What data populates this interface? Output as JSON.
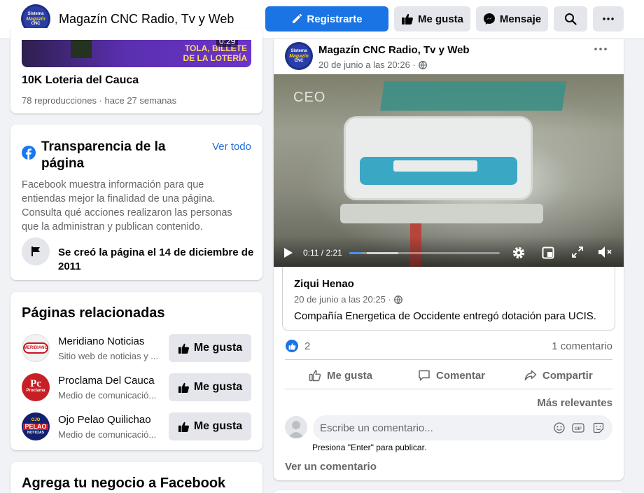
{
  "topbar": {
    "page_name": "Magazín CNC Radio, Tv y Web",
    "register_label": "Registrarte",
    "like_label": "Me gusta",
    "message_label": "Mensaje"
  },
  "video_card": {
    "duration_badge": "0:29",
    "banner_text": "TOLA, BILLETE DE LA LOTERÍA",
    "title": "10K Loteria del Cauca",
    "meta": "78 reproducciones · hace 27 semanas"
  },
  "transparency": {
    "title": "Transparencia de la página",
    "see_all": "Ver todo",
    "description": "Facebook muestra información para que entiendas mejor la finalidad de una página. Consulta qué acciones realizaron las personas que la administran y publican contenido.",
    "created": "Se creó la página el 14 de diciembre de 2011"
  },
  "related": {
    "title": "Páginas relacionadas",
    "like_label": "Me gusta",
    "items": [
      {
        "name": "Meridiano Noticias",
        "desc": "Sitio web de noticias y ..."
      },
      {
        "name": "Proclama Del Cauca",
        "desc": "Medio de comunicació..."
      },
      {
        "name": "Ojo Pelao Quilichao",
        "desc": "Medio de comunicació..."
      }
    ]
  },
  "business": {
    "title": "Agrega tu negocio a Facebook"
  },
  "post": {
    "author": "Magazín CNC Radio, Tv y Web",
    "date": "20 de junio a las 20:26 ·",
    "video": {
      "watermark": "CEO",
      "time": "0:11 / 2:21",
      "progress": 0.08
    },
    "shared": {
      "author": "Ziqui Henao",
      "date": "20 de junio a las 20:25 ·",
      "text": "Compañía Energetica de Occidente entregó dotación para UCIS."
    },
    "reactions_count": "2",
    "comments_count": "1 comentario",
    "actions": {
      "like": "Me gusta",
      "comment": "Comentar",
      "share": "Compartir"
    },
    "sort_label": "Más relevantes",
    "comment_placeholder": "Escribe un comentario...",
    "enter_hint": "Presiona \"Enter\" para publicar.",
    "view_comment": "Ver un comentario"
  },
  "colors": {
    "accent": "#1b74e4",
    "link": "#216fdb",
    "muted": "#65676b"
  }
}
